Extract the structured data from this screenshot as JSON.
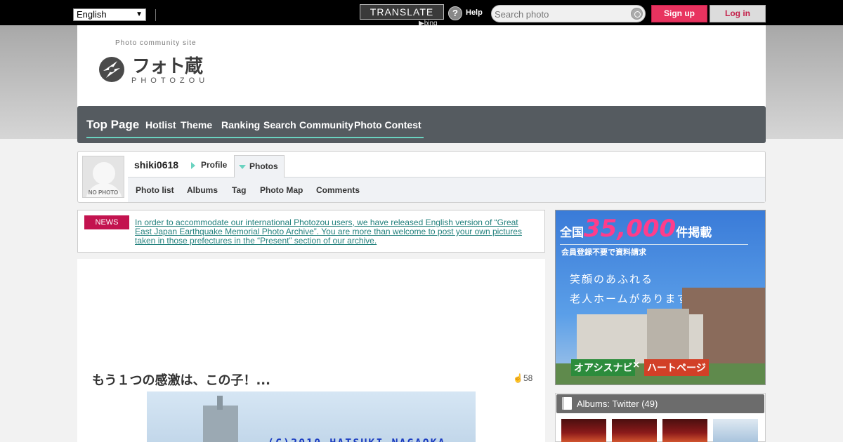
{
  "topbar": {
    "language": "English",
    "translate_label": "TRANSLATE",
    "translate_powered_by": "bing",
    "help_icon": "question-mark-icon",
    "help_label": "Help",
    "search_placeholder": "Search photo",
    "signup_label": "Sign up",
    "login_label": "Log in"
  },
  "header": {
    "tagline": "Photo community site",
    "logo_jp": "フォト蔵",
    "logo_en": "PHOTOZOU"
  },
  "nav": {
    "items": [
      "Top Page",
      "Hotlist",
      "Theme",
      "Ranking",
      "Search",
      "Community",
      "Photo Contest"
    ]
  },
  "profile": {
    "avatar_text": "NO PHOTO",
    "username": "shiki0618",
    "tabs": [
      "Profile",
      "Photos"
    ],
    "sub_items": [
      "Photo list",
      "Albums",
      "Tag",
      "Photo Map",
      "Comments"
    ]
  },
  "news": {
    "badge": "NEWS",
    "text": "In order to accommodate our international Photozou users, we have released English version of “Great East Japan Earthquake Memorial Photo Archive”. You are more than welcome to post your own pictures taken in those prefectures in the “Present” section of our archive."
  },
  "photo": {
    "title": "もう１つの感激は、この子！...",
    "fav_count": "58",
    "watermark": "(C)2010 HATSUKI NAGAOKA"
  },
  "ad": {
    "prefix": "全国",
    "number": "35,000",
    "suffix": "件掲載",
    "subline": "会員登録不要で資料請求",
    "copy_line1": "笑顔のあふれる",
    "copy_line2": "老人ホームがあります。",
    "brand1": "オアシスナビ",
    "cross": "×",
    "brand2": "ハートページ"
  },
  "albums": {
    "title": "Albums: Twitter (49)"
  },
  "colors": {
    "accent": "#6ad3c0",
    "signup": "#e8335f",
    "news_badge": "#c3134f",
    "nav_bg": "#555b60"
  }
}
